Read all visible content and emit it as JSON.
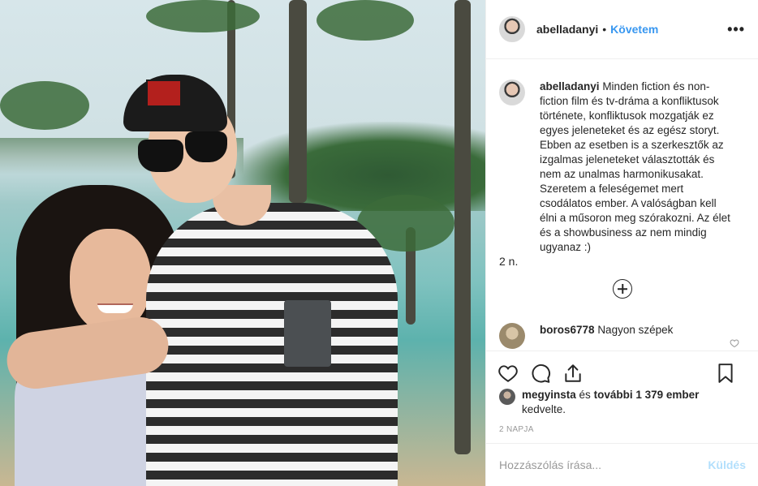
{
  "post": {
    "author": "abelladanyi",
    "follow_label": "Követem",
    "separator": "•",
    "more_label": "•••"
  },
  "caption": {
    "author": "abelladanyi",
    "text": "Minden fiction és non-fiction film és tv-dráma a konfliktusok története, konfliktusok mozgatják ez egyes jeleneteket és az egész storyt. Ebben az esetben is a szerkesztők az izgalmas jeleneteket választották és nem az unalmas harmonikusakat. Szeretem a feleségemet mert csodálatos ember. A valóságban kell élni a műsoron meg szórakozni. Az élet és a showbusiness az nem mindig ugyanaz :)",
    "time": "2 n."
  },
  "comments": [
    {
      "author": "boros6778",
      "text": "Nagyon szépek"
    }
  ],
  "likes": {
    "user": "megyinsta",
    "text_connector": "és",
    "others": "további 1 379 ember",
    "suffix": "kedvelte."
  },
  "date": "2 NAPJA",
  "add_comment": {
    "placeholder": "Hozzászólás írása...",
    "post_label": "Küldés"
  },
  "icons": [
    "heart-icon",
    "comment-icon",
    "share-icon",
    "bookmark-icon",
    "plus-circle-icon",
    "more-icon"
  ],
  "colors": {
    "accent": "#3897f0",
    "post_disabled": "#b2dffc",
    "muted": "#999999"
  }
}
